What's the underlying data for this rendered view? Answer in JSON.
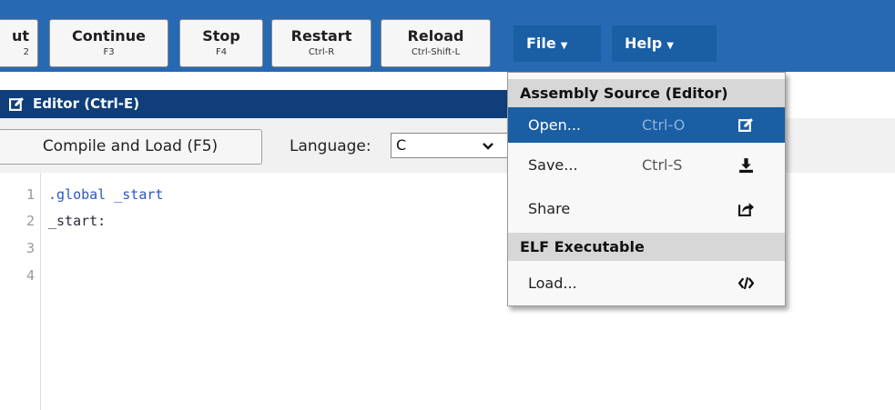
{
  "toolbar": {
    "buttons": [
      {
        "label": "ut",
        "shortcut": "2"
      },
      {
        "label": "Continue",
        "shortcut": "F3"
      },
      {
        "label": "Stop",
        "shortcut": "F4"
      },
      {
        "label": "Restart",
        "shortcut": "Ctrl-R"
      },
      {
        "label": "Reload",
        "shortcut": "Ctrl-Shift-L"
      }
    ],
    "menus": [
      {
        "label": "File"
      },
      {
        "label": "Help"
      }
    ]
  },
  "editor": {
    "title": "Editor (Ctrl-E)",
    "compile_label": "Compile and Load (F5)",
    "language_label": "Language:",
    "language_value": "C",
    "line_numbers": [
      "1",
      "2",
      "3",
      "4"
    ],
    "lines": [
      ".global _start",
      "_start:",
      "",
      ""
    ]
  },
  "file_menu": {
    "sections": [
      {
        "title": "Assembly Source (Editor)",
        "items": [
          {
            "label": "Open...",
            "shortcut": "Ctrl-O",
            "icon": "edit-icon"
          },
          {
            "label": "Save...",
            "shortcut": "Ctrl-S",
            "icon": "download-icon"
          },
          {
            "label": "Share",
            "shortcut": "",
            "icon": "share-icon"
          }
        ]
      },
      {
        "title": "ELF Executable",
        "items": [
          {
            "label": "Load...",
            "shortcut": "",
            "icon": "code-icon"
          }
        ]
      }
    ]
  },
  "colors": {
    "toolbar_bg": "#2869b3",
    "menu_btn_bg": "#1a5ea4",
    "editor_header_bg": "#0f3e7a",
    "active_item_bg": "#1a5ea4",
    "code_keyword": "#2c55c3"
  }
}
